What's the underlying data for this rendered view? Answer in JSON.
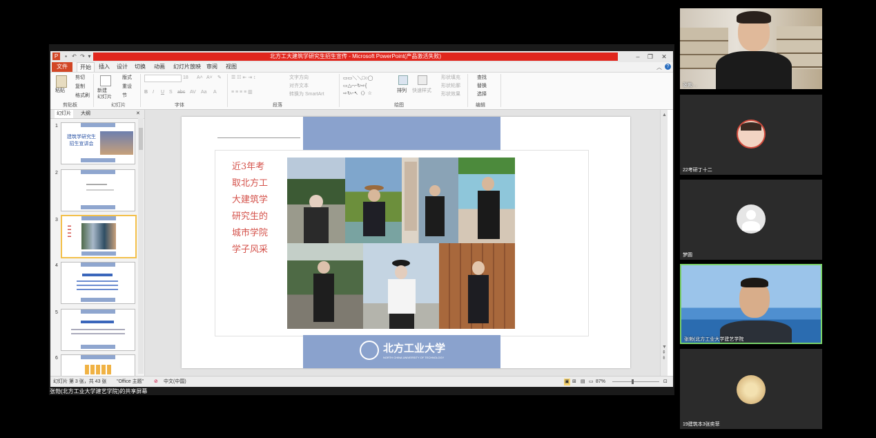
{
  "ppt": {
    "window_title": "北方工大建筑学研究生招生宣传 - Microsoft PowerPoint(产品激活失败)",
    "tabs": [
      "文件",
      "开始",
      "插入",
      "设计",
      "切换",
      "动画",
      "幻灯片放映",
      "审阅",
      "视图"
    ],
    "active_tab": "开始",
    "ribbon": {
      "clipboard": {
        "paste": "粘贴",
        "cut": "剪切",
        "copy": "复制",
        "format_painter": "格式刷",
        "label": "剪贴板"
      },
      "slides": {
        "new_slide": "新建\n幻灯片",
        "layout": "版式",
        "reset": "重设",
        "section": "节",
        "label": "幻灯片"
      },
      "font": {
        "font_name": "",
        "font_size": "18",
        "label": "字体",
        "buttons": [
          "B",
          "I",
          "U",
          "S",
          "abc",
          "AV",
          "Aa"
        ]
      },
      "paragraph": {
        "text_direction": "文字方向",
        "align_text": "对齐文本",
        "convert_smartart": "转换为 SmartArt",
        "label": "段落"
      },
      "drawing": {
        "arrange": "排列",
        "quick_styles": "快速样式",
        "shape_fill": "形状填充",
        "shape_outline": "形状轮廓",
        "shape_effects": "形状效果",
        "label": "绘图"
      },
      "editing": {
        "find": "查找",
        "replace": "替换",
        "select": "选择",
        "label": "编辑"
      }
    },
    "pane_tabs": [
      "幻灯片",
      "大纲"
    ],
    "thumbnails": [
      {
        "num": "1",
        "title": "建筑学研究生\n招生宣讲会"
      },
      {
        "num": "2",
        "title": ""
      },
      {
        "num": "3",
        "title": ""
      },
      {
        "num": "4",
        "title": ""
      },
      {
        "num": "5",
        "title": ""
      },
      {
        "num": "6",
        "title": ""
      }
    ],
    "status": {
      "slide_info": "幻灯片 第 3 张，共 43 张",
      "theme": "\"Office 主题\"",
      "language": "中文(中国)",
      "zoom": "87%"
    }
  },
  "slide": {
    "heading_lines": [
      "近3年考",
      "取北方工",
      "大建筑学",
      "研究生的",
      "城市学院",
      "学子风采"
    ],
    "logo_text": "北方工业大学",
    "logo_subtext": "NORTH CHINA UNIVERSITY OF TECHNOLOGY"
  },
  "share_caption": "张勃(北方工业大学建艺学院)的共享屏幕",
  "participants": [
    {
      "name": "张勃…",
      "has_video": true
    },
    {
      "name": "22考研丁十二",
      "has_video": false,
      "avatar": "cartoon"
    },
    {
      "name": "梦圆",
      "has_video": false,
      "avatar": "default"
    },
    {
      "name": "张勃(北方工业大学建艺学院",
      "has_video": true,
      "active_speaker": true
    },
    {
      "name": "19建筑本3张奕菲",
      "has_video": false,
      "avatar": "photo"
    }
  ],
  "colors": {
    "ppt_red": "#d24726",
    "slide_band": "#8aa2cd",
    "slide_text": "#d4514a",
    "active_speaker": "#7bd36b"
  }
}
